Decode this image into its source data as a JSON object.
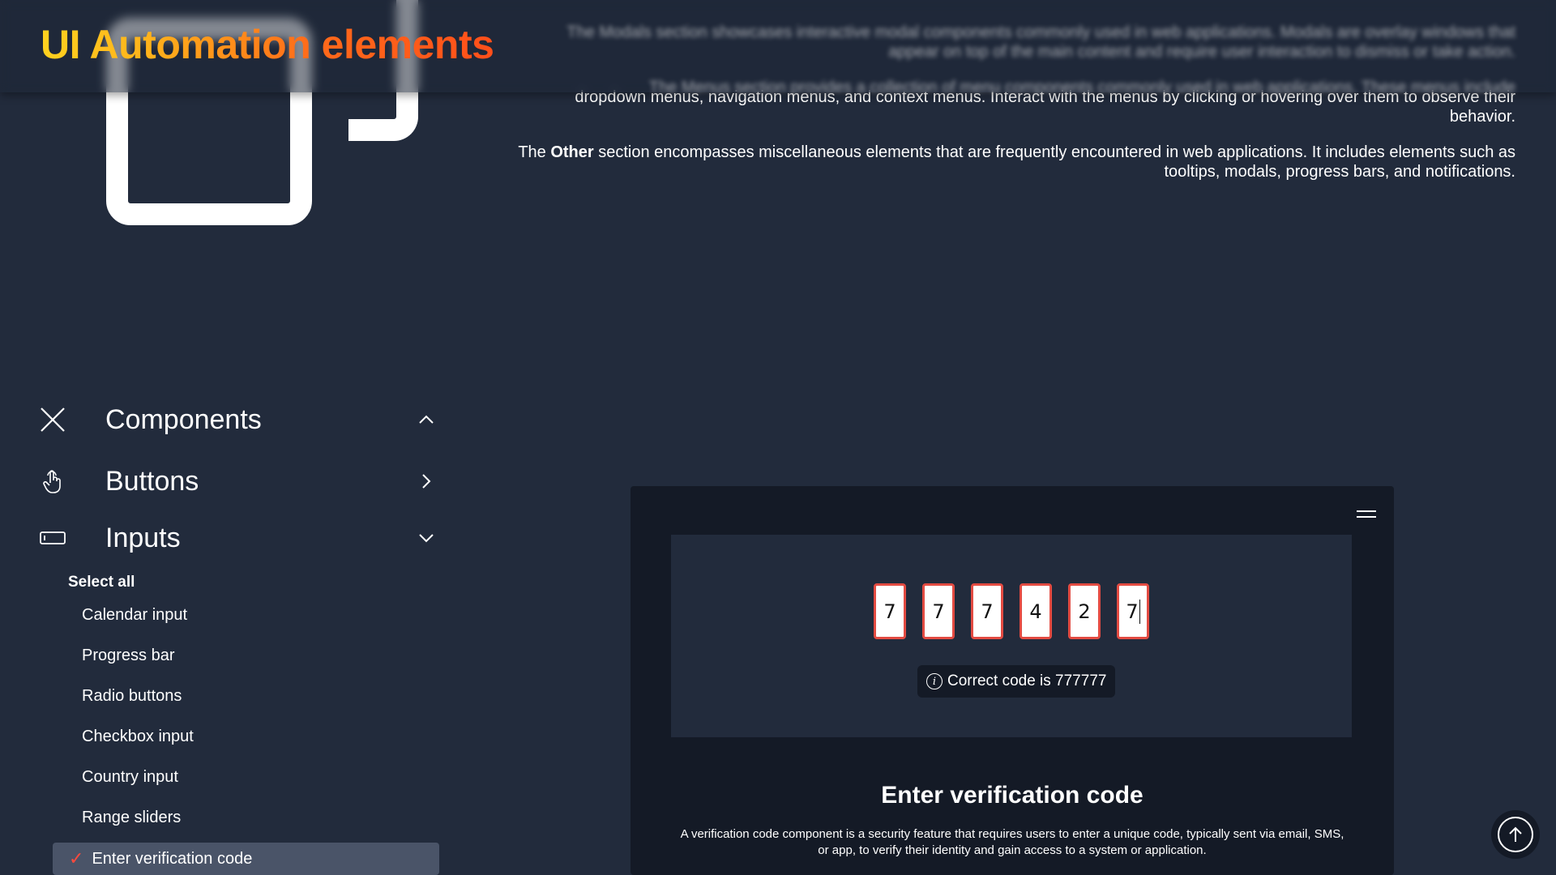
{
  "header": {
    "title": "UI Automation elements",
    "blurred_line1": "The Modals section showcases interactive modal components commonly used in web applications. Modals are overlay windows that appear on top of the main content and require user interaction to dismiss or take action.",
    "blurred_line2": "The Menus section provides a collection of menu components commonly used in web applications. These menus include"
  },
  "intro": {
    "menus_tail": "dropdown menus, navigation menus, and context menus. Interact with the menus by clicking or hovering over them to observe their behavior.",
    "other_prefix": "The",
    "other_bold": "Other",
    "other_rest": "section encompasses miscellaneous elements that are frequently encountered in web applications. It includes elements such as tooltips, modals, progress bars, and notifications."
  },
  "sidebar": {
    "components_label": "Components",
    "buttons_label": "Buttons",
    "inputs_label": "Inputs",
    "select_all": "Select all",
    "items": [
      "Calendar input",
      "Progress bar",
      "Radio buttons",
      "Checkbox input",
      "Country input",
      "Range sliders",
      "Enter verification code"
    ],
    "active_check": "✓"
  },
  "demo": {
    "digits": [
      "7",
      "7",
      "7",
      "4",
      "2",
      "7"
    ],
    "hint_icon": "i",
    "hint": "Correct code is 777777",
    "title": "Enter verification code",
    "description": "A verification code component is a security feature that requires users to enter a unique code, typically sent via email, SMS, or app, to verify their identity and gain access to a system or application."
  },
  "icons": {
    "close": "close-icon",
    "hand": "pointer-hand-icon",
    "input": "input-field-icon",
    "scroll": "arrow-up-icon"
  },
  "colors": {
    "background": "#222b3c",
    "card": "#141a26",
    "accent_red": "#e34b42",
    "title_gradient_start": "#ffd21f",
    "title_gradient_end": "#ff4f1a"
  }
}
